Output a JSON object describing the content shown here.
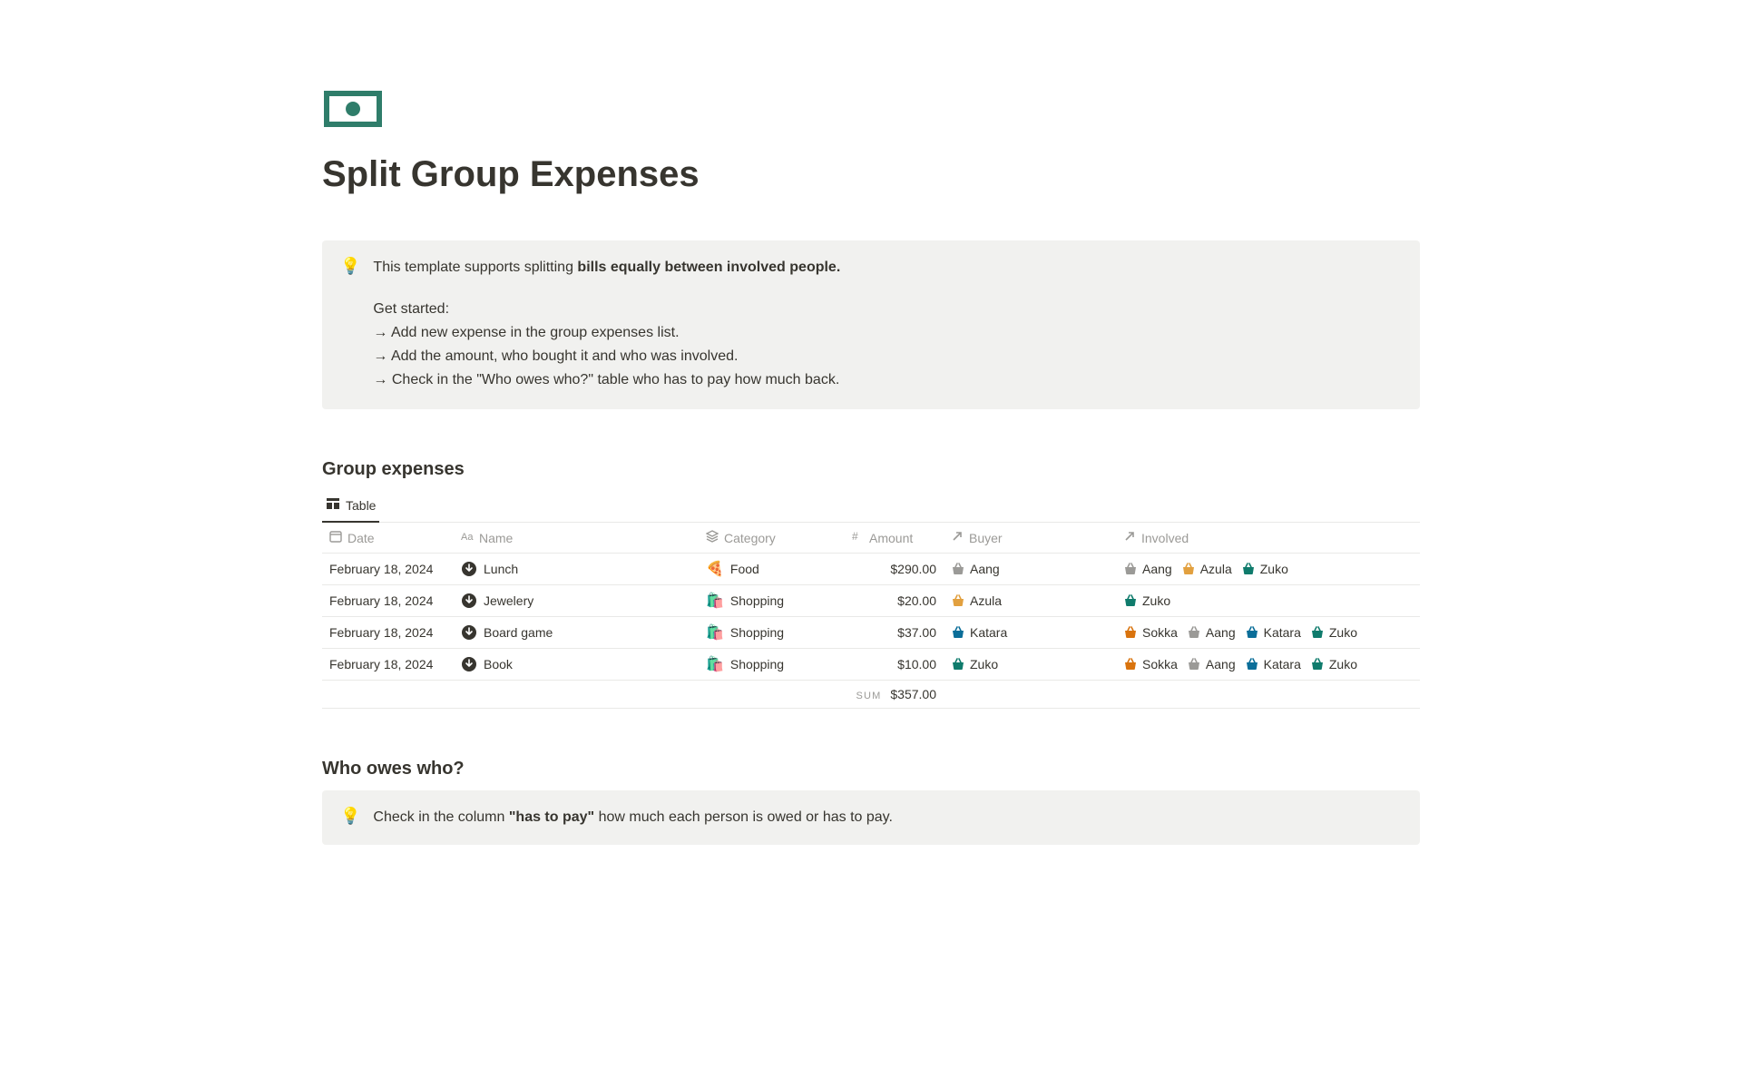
{
  "page": {
    "title": "Split Group Expenses"
  },
  "callout1": {
    "icon": "💡",
    "intro_prefix": "This template supports splitting ",
    "intro_bold": "bills equally between involved people.",
    "get_started_label": "Get started:",
    "step1": "→ Add new expense in the group expenses list.",
    "step2": "→ Add the amount, who bought it and who was involved.",
    "step3": "→ Check in the \"Who owes who?\" table who has to pay how much back."
  },
  "db": {
    "heading": "Group expenses",
    "tab_label": "Table",
    "columns": {
      "date": "Date",
      "name": "Name",
      "category": "Category",
      "amount": "Amount",
      "buyer": "Buyer",
      "involved": "Involved"
    },
    "rows": [
      {
        "date": "February 18, 2024",
        "name": "Lunch",
        "category_emoji": "🍕",
        "category": "Food",
        "amount": "$290.00",
        "buyer": {
          "color": "#9b9a97",
          "name": "Aang"
        },
        "involved": [
          {
            "color": "#9b9a97",
            "name": "Aang"
          },
          {
            "color": "#e2a03f",
            "name": "Azula"
          },
          {
            "color": "#0f7b6c",
            "name": "Zuko"
          }
        ]
      },
      {
        "date": "February 18, 2024",
        "name": "Jewelery",
        "category_emoji": "🛍️",
        "category": "Shopping",
        "amount": "$20.00",
        "buyer": {
          "color": "#e2a03f",
          "name": "Azula"
        },
        "involved": [
          {
            "color": "#0f7b6c",
            "name": "Zuko"
          }
        ]
      },
      {
        "date": "February 18, 2024",
        "name": "Board game",
        "category_emoji": "🛍️",
        "category": "Shopping",
        "amount": "$37.00",
        "buyer": {
          "color": "#0b6e99",
          "name": "Katara"
        },
        "involved": [
          {
            "color": "#d9730d",
            "name": "Sokka"
          },
          {
            "color": "#9b9a97",
            "name": "Aang"
          },
          {
            "color": "#0b6e99",
            "name": "Katara"
          },
          {
            "color": "#0f7b6c",
            "name": "Zuko"
          }
        ]
      },
      {
        "date": "February 18, 2024",
        "name": "Book",
        "category_emoji": "🛍️",
        "category": "Shopping",
        "amount": "$10.00",
        "buyer": {
          "color": "#0f7b6c",
          "name": "Zuko"
        },
        "involved": [
          {
            "color": "#d9730d",
            "name": "Sokka"
          },
          {
            "color": "#9b9a97",
            "name": "Aang"
          },
          {
            "color": "#0b6e99",
            "name": "Katara"
          },
          {
            "color": "#0f7b6c",
            "name": "Zuko"
          }
        ]
      }
    ],
    "sum_label": "SUM",
    "sum_value": "$357.00"
  },
  "owes": {
    "heading": "Who owes who?",
    "callout_icon": "💡",
    "callout_prefix": "Check in the column ",
    "callout_bold": "\"has to pay\"",
    "callout_suffix": " how much each person is owed or has to pay."
  }
}
